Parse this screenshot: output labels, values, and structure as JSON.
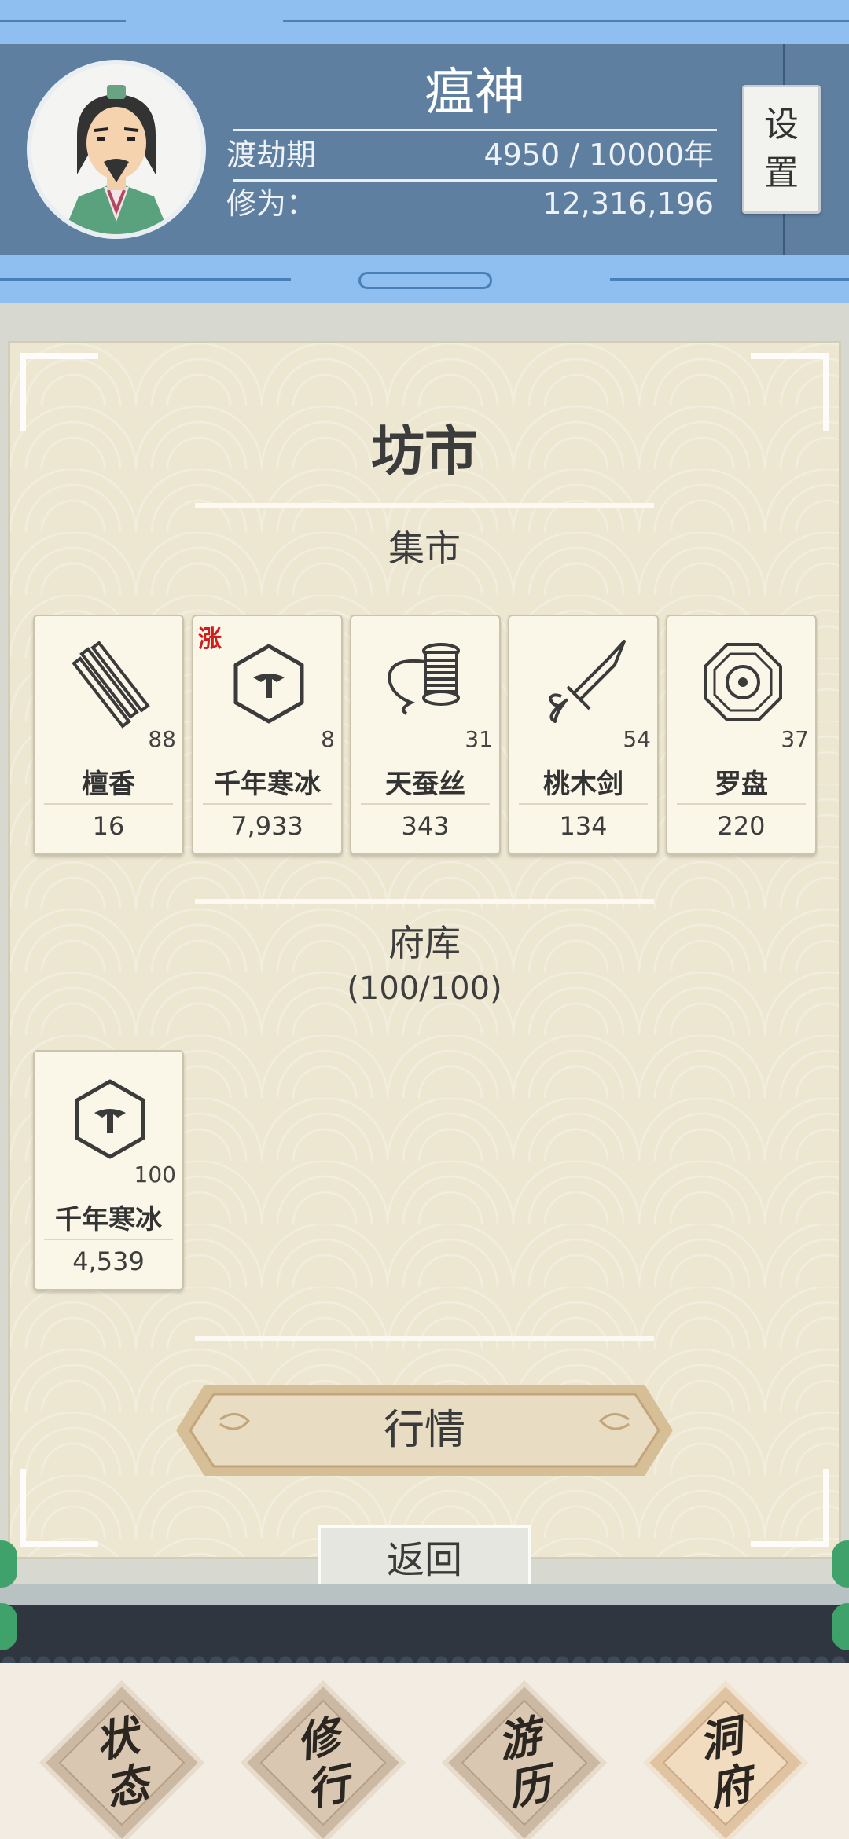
{
  "header": {
    "name": "瘟神",
    "realm_label": "渡劫期",
    "lifespan": "4950 / 10000年",
    "cultivation_label": "修为：",
    "cultivation_value": "12,316,196",
    "settings_label_1": "设",
    "settings_label_2": "置"
  },
  "page": {
    "title": "坊市",
    "market_section": "集市",
    "storage_section": "府库",
    "storage_capacity": "(100/100)",
    "quotes_button": "行情",
    "back_button": "返回"
  },
  "market_items": [
    {
      "name": "檀香",
      "qty": "88",
      "price": "16",
      "icon": "incense-icon"
    },
    {
      "name": "千年寒冰",
      "qty": "8",
      "price": "7,933",
      "icon": "ice-icon",
      "badge": "涨"
    },
    {
      "name": "天蚕丝",
      "qty": "31",
      "price": "343",
      "icon": "silk-spool-icon"
    },
    {
      "name": "桃木剑",
      "qty": "54",
      "price": "134",
      "icon": "wooden-sword-icon"
    },
    {
      "name": "罗盘",
      "qty": "37",
      "price": "220",
      "icon": "compass-icon"
    }
  ],
  "storage_items": [
    {
      "name": "千年寒冰",
      "qty": "100",
      "price": "4,539",
      "icon": "ice-icon"
    }
  ],
  "nav": {
    "status": [
      "状",
      "态"
    ],
    "cultivate": [
      "修",
      "行"
    ],
    "travel": [
      "游",
      "历"
    ],
    "cave": [
      "洞",
      "府"
    ]
  },
  "colors": {
    "header_bg": "#5f7fa0",
    "sky_band": "#8fbff0",
    "panel_bg": "#ede7d2",
    "rise_red": "#d21d1d"
  }
}
